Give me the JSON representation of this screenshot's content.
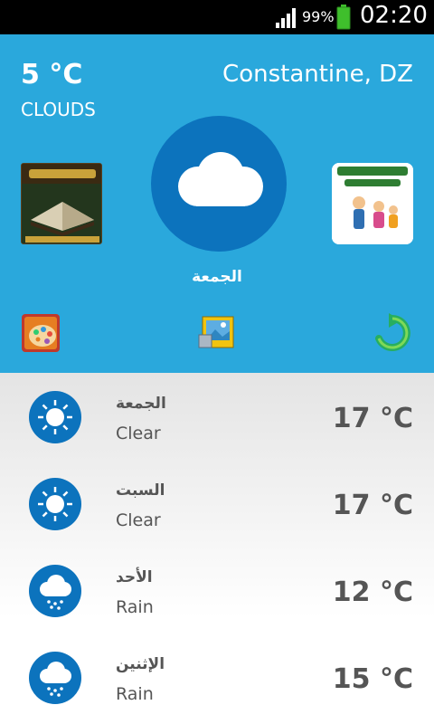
{
  "status_bar": {
    "battery_percent": "99%",
    "battery_level": 0.99,
    "time": "02:20",
    "signal_icon": "signal-bars-icon",
    "battery_icon": "battery-icon"
  },
  "current": {
    "temperature": "5 °C",
    "condition": "CLOUDS",
    "city": "Constantine, DZ",
    "day": "الجمعة",
    "icon": "cloud-icon"
  },
  "promos": {
    "left_icon": "quran-app-icon",
    "right_icon": "children-education-app-icon"
  },
  "toolbar": {
    "left_icon": "palette-icon",
    "center_icon": "photo-edit-icon",
    "right_icon": "refresh-icon"
  },
  "forecast": [
    {
      "day": "الجمعة",
      "condition": "Clear",
      "temperature": "17 °C",
      "icon": "sun-icon"
    },
    {
      "day": "السبت",
      "condition": "Clear",
      "temperature": "17 °C",
      "icon": "sun-icon"
    },
    {
      "day": "الأحد",
      "condition": "Rain",
      "temperature": "12 °C",
      "icon": "rain-cloud-icon"
    },
    {
      "day": "الإثنين",
      "condition": "Rain",
      "temperature": "15 °C",
      "icon": "rain-cloud-icon"
    }
  ],
  "colors": {
    "header_bg": "#2aa8dc",
    "icon_circle": "#0c73bd",
    "text_dark": "#555555",
    "battery_fill": "#3fbf2c"
  }
}
